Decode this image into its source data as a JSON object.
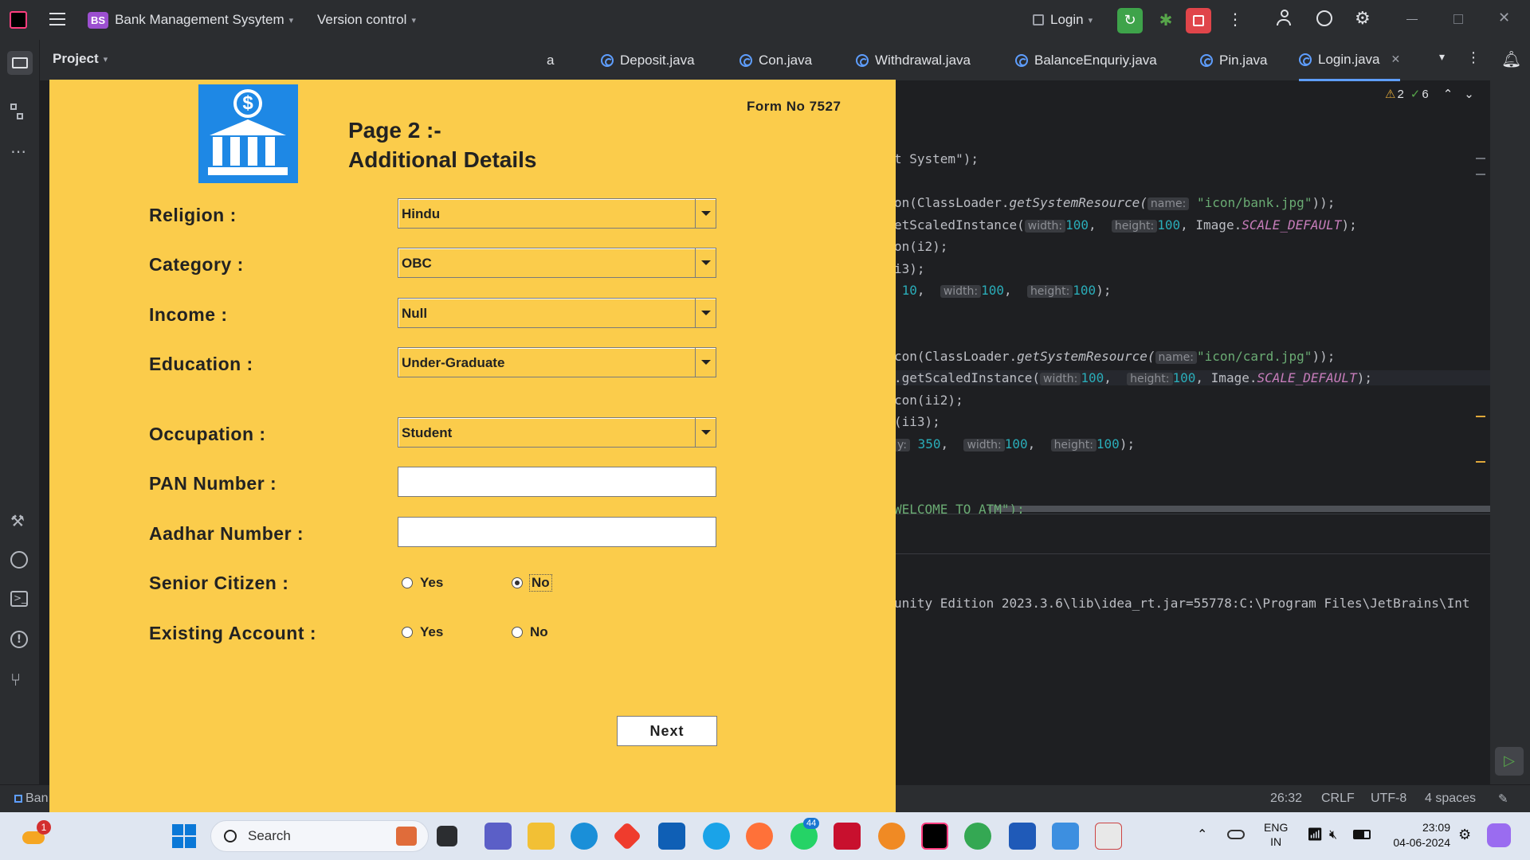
{
  "titlebar": {
    "project_badge": "BS",
    "project_name": "Bank Management Sysytem",
    "version_control": "Version control",
    "run_config": "Login"
  },
  "left_panel": {
    "project_label": "Project"
  },
  "tabs": [
    {
      "label": "a"
    },
    {
      "label": "Deposit.java"
    },
    {
      "label": "Con.java"
    },
    {
      "label": "Withdrawal.java"
    },
    {
      "label": "BalanceEnquriy.java"
    },
    {
      "label": "Pin.java"
    },
    {
      "label": "Login.java",
      "active": true
    }
  ],
  "inspections": {
    "warnings": "2",
    "weak_warnings": "6"
  },
  "code_lines": [
    {
      "parts": [
        "t System\");"
      ]
    },
    {
      "parts": [
        "on(ClassLoader.",
        "getSystemResource(",
        "name:",
        "\"icon/bank.jpg\"",
        "));"
      ]
    },
    {
      "parts": [
        "etScaledInstance(",
        "width:",
        "100",
        ", ",
        "height:",
        "100",
        ", Image.",
        "SCALE_DEFAULT",
        ");"
      ]
    },
    {
      "parts": [
        "on(i2);"
      ]
    },
    {
      "parts": [
        "i3);"
      ]
    },
    {
      "parts": [
        "10",
        ",  ",
        "width:",
        "100",
        ",  ",
        "height:",
        "100",
        ");"
      ]
    },
    {
      "parts": [
        "con(ClassLoader.",
        "getSystemResource(",
        "name:",
        "\"icon/card.jpg\"",
        "));"
      ]
    },
    {
      "parts": [
        ".getScaledInstance(",
        "width:",
        "100",
        ",  ",
        "height:",
        "100",
        ", Image.",
        "SCALE_DEFAULT",
        ");"
      ]
    },
    {
      "parts": [
        "con(ii2);"
      ]
    },
    {
      "parts": [
        "(ii3);"
      ]
    },
    {
      "parts": [
        "y:",
        "350",
        ",  ",
        "width:",
        "100",
        ",  ",
        "height:",
        "100",
        ");"
      ]
    },
    {
      "parts": [
        "WELCOME TO ATM\");"
      ]
    }
  ],
  "run_output": "unity Edition 2023.3.6\\lib\\idea_rt.jar=55778:C:\\Program Files\\JetBrains\\Int",
  "statusbar": {
    "left": "Ban",
    "position": "26:32",
    "line_sep": "CRLF",
    "encoding": "UTF-8",
    "indent": "4 spaces"
  },
  "form": {
    "form_no": "Form No 7527",
    "page_title": "Page 2 :-",
    "page_subtitle": "Additional Details",
    "religion_label": "Religion :",
    "religion_value": "Hindu",
    "category_label": "Category :",
    "category_value": "OBC",
    "income_label": "Income :",
    "income_value": "Null",
    "education_label": "Education :",
    "education_value": "Under-Graduate",
    "occupation_label": "Occupation :",
    "occupation_value": "Student",
    "pan_label": "PAN Number :",
    "pan_value": "",
    "aadhar_label": "Aadhar Number :",
    "aadhar_value": "",
    "senior_label": "Senior Citizen :",
    "senior_yes": "Yes",
    "senior_no": "No",
    "senior_selected": "No",
    "existing_label": "Existing Account :",
    "existing_yes": "Yes",
    "existing_no": "No",
    "next_label": "Next"
  },
  "taskbar": {
    "search_placeholder": "Search",
    "badge_weather": "1",
    "badge_whatsapp": "44",
    "lang_top": "ENG",
    "lang_bottom": "IN",
    "time": "23:09",
    "date": "04-06-2024"
  },
  "colors": {
    "form_bg": "#fbcc4b",
    "ide_bg": "#1e1f22",
    "ide_panel": "#2b2d30",
    "accent_blue": "#1e88e5",
    "run_green": "#3ea34a",
    "stop_red": "#e0454a"
  }
}
